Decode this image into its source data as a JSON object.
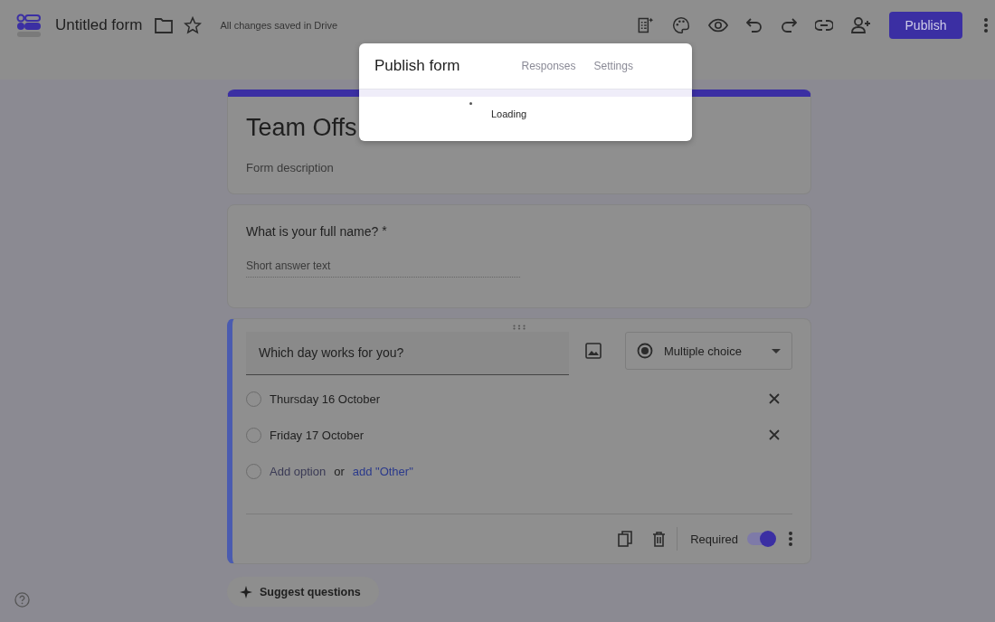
{
  "header": {
    "title": "Untitled form",
    "save_status": "All changes saved in Drive",
    "publish_label": "Publish"
  },
  "dialog": {
    "title": "Publish form",
    "tabs": [
      {
        "label": "Responses",
        "selected": false
      },
      {
        "label": "Settings",
        "selected": false
      }
    ],
    "progress": {
      "level": 1
    },
    "status": "Loading"
  },
  "form": {
    "title": "Team Offs",
    "description_placeholder": "Form description"
  },
  "questions": [
    {
      "kind": "short",
      "title": "What is your full name?",
      "required": true,
      "required_mark": "*",
      "answer_placeholder": "Short answer text"
    },
    {
      "kind": "choice",
      "title": "Which day works for you?",
      "type_label": "Multiple choice",
      "options": [
        {
          "label": "Thursday 16 October",
          "selected": false
        },
        {
          "label": "Friday 17 October",
          "selected": false
        }
      ],
      "add_row": {
        "selected": false,
        "add_option": "Add option",
        "or": "or",
        "add_other": "add \"Other\""
      },
      "required_label": "Required",
      "required": true
    }
  ],
  "suggest_label": "Suggest questions"
}
